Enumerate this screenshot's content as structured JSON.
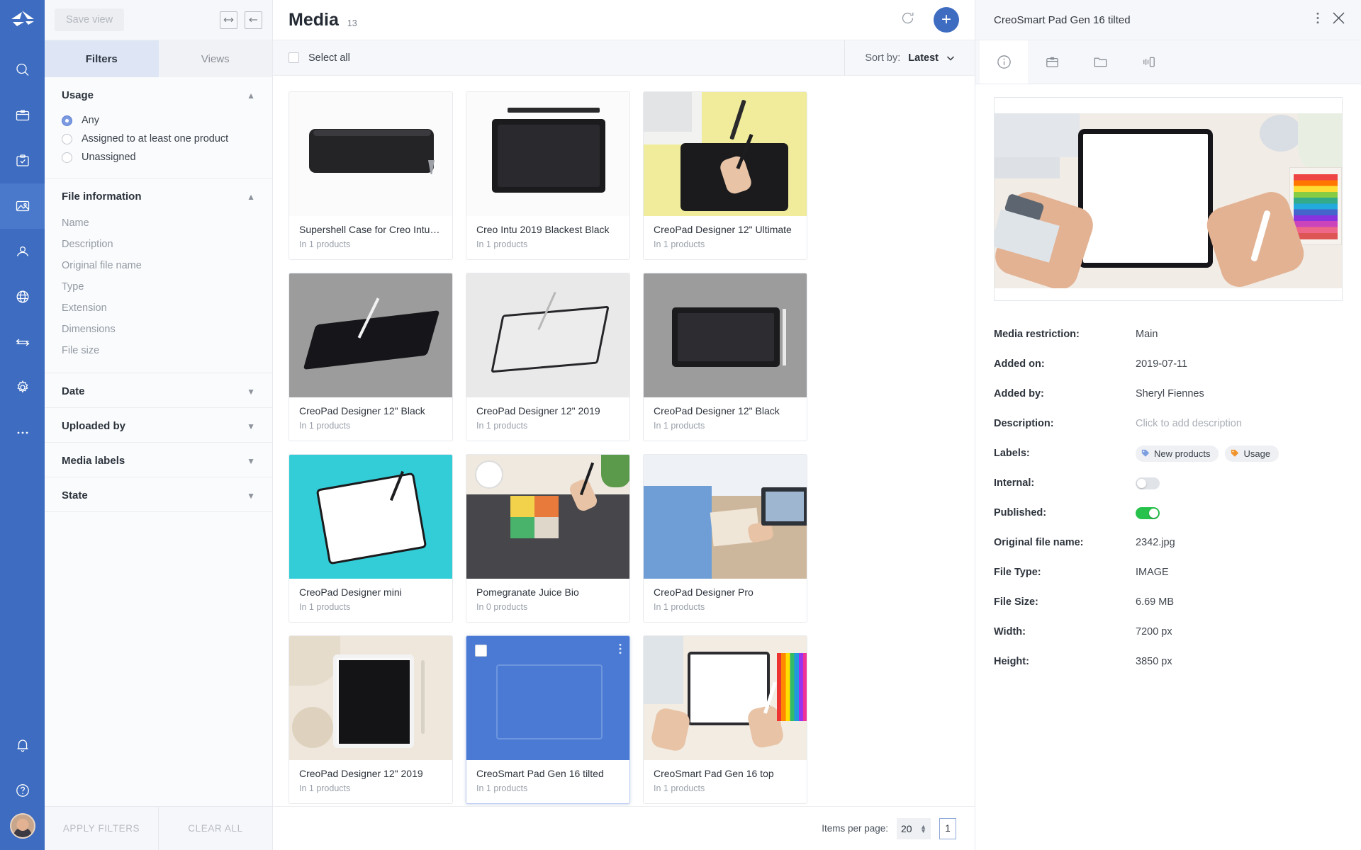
{
  "rail": {
    "logo_name": "app-logo",
    "items": [
      {
        "name": "search-icon",
        "label": "Search"
      },
      {
        "name": "products-icon",
        "label": "Products"
      },
      {
        "name": "tasks-icon",
        "label": "Tasks"
      },
      {
        "name": "media-icon",
        "label": "Media",
        "active": true
      },
      {
        "name": "users-icon",
        "label": "Users"
      },
      {
        "name": "globe-icon",
        "label": "Channels"
      },
      {
        "name": "transfer-icon",
        "label": "Import Export"
      },
      {
        "name": "gear-icon",
        "label": "Settings"
      },
      {
        "name": "more-icon",
        "label": "More"
      }
    ],
    "notifications_icon": "bell-icon",
    "help_icon": "help-icon",
    "avatar": "user-avatar"
  },
  "filters": {
    "save_view_label": "Save view",
    "expand_icon": "expand-horizontal-icon",
    "collapse_icon": "collapse-left-icon",
    "tabs": [
      {
        "label": "Filters",
        "active": true
      },
      {
        "label": "Views",
        "active": false
      }
    ],
    "groups": [
      {
        "title": "Usage",
        "expanded": true,
        "options": [
          {
            "label": "Any",
            "selected": true
          },
          {
            "label": "Assigned to at least one product",
            "selected": false
          },
          {
            "label": "Unassigned",
            "selected": false
          }
        ]
      },
      {
        "title": "File information",
        "expanded": true,
        "items": [
          "Name",
          "Description",
          "Original file name",
          "Type",
          "Extension",
          "Dimensions",
          "File size"
        ]
      },
      {
        "title": "Date",
        "expanded": false
      },
      {
        "title": "Uploaded by",
        "expanded": false
      },
      {
        "title": "Media labels",
        "expanded": false
      },
      {
        "title": "State",
        "expanded": false
      }
    ],
    "apply_label": "APPLY FILTERS",
    "clear_label": "CLEAR ALL"
  },
  "main": {
    "title": "Media",
    "count": "13",
    "refresh_icon": "refresh-icon",
    "add_icon": "plus-icon",
    "select_all_label": "Select all",
    "sort_by_label": "Sort by:",
    "sort_by_value": "Latest",
    "cards": [
      {
        "title": "Supershell Case for Creo Intu …",
        "sub": "In 1 products",
        "art": "case",
        "selected": false
      },
      {
        "title": "Creo Intu 2019 Blackest Black",
        "sub": "In 1 products",
        "art": "tablet-pen-white",
        "selected": false
      },
      {
        "title": "CreoPad Designer 12\" Ultimate",
        "sub": "In 1 products",
        "art": "yellow-desk",
        "selected": false
      },
      {
        "title": "CreoPad Designer 12\" Black",
        "sub": "In 1 products",
        "art": "grey-tilt",
        "selected": false
      },
      {
        "title": "CreoPad Designer 12\" 2019",
        "sub": "In 1 products",
        "art": "lgrey-outline",
        "selected": false
      },
      {
        "title": "CreoPad Designer 12\" Black",
        "sub": "In 1 products",
        "art": "grey-flat",
        "selected": false
      },
      {
        "title": "CreoPad Designer mini",
        "sub": "In 1 products",
        "art": "teal-tablet",
        "selected": false
      },
      {
        "title": "Pomegranate Juice Bio",
        "sub": "In 0 products",
        "art": "desk-swatch",
        "selected": false
      },
      {
        "title": "CreoPad Designer Pro",
        "sub": "In 1 products",
        "art": "office-desk",
        "selected": false
      },
      {
        "title": "CreoPad Designer 12\" 2019",
        "sub": "In 1 products",
        "art": "wood-tablet",
        "selected": false
      },
      {
        "title": "CreoSmart Pad Gen 16 tilted",
        "sub": "In 1 products",
        "art": "selected-blue",
        "selected": true
      },
      {
        "title": "CreoSmart Pad Gen 16 top",
        "sub": "In 1 products",
        "art": "hands-tablet",
        "selected": false
      }
    ],
    "items_per_page_label": "Items per page:",
    "items_per_page_value": "20",
    "page_value": "1"
  },
  "detail": {
    "title": "CreoSmart Pad Gen 16 tilted",
    "more_icon": "more-vertical-icon",
    "close_icon": "close-icon",
    "tabs": [
      {
        "name": "info-icon",
        "active": true
      },
      {
        "name": "product-icon",
        "active": false
      },
      {
        "name": "folder-icon",
        "active": false
      },
      {
        "name": "variants-icon",
        "active": false
      }
    ],
    "properties": [
      {
        "key": "Media restriction:",
        "value": "Main",
        "type": "text"
      },
      {
        "key": "Added on:",
        "value": "2019-07-11",
        "type": "text"
      },
      {
        "key": "Added by:",
        "value": "Sheryl Fiennes",
        "type": "text"
      },
      {
        "key": "Description:",
        "value": "Click to add description",
        "type": "placeholder"
      },
      {
        "key": "Labels:",
        "type": "chips",
        "chips": [
          {
            "label": "New products",
            "color": "#7d9fe0"
          },
          {
            "label": "Usage",
            "color": "#f0932b"
          }
        ]
      },
      {
        "key": "Internal:",
        "type": "toggle",
        "on": false
      },
      {
        "key": "Published:",
        "type": "toggle",
        "on": true
      },
      {
        "key": "Original file name:",
        "value": "2342.jpg",
        "type": "text"
      },
      {
        "key": "File Type:",
        "value": "IMAGE",
        "type": "text"
      },
      {
        "key": "File Size:",
        "value": "6.69 MB",
        "type": "text"
      },
      {
        "key": "Width:",
        "value": "7200 px",
        "type": "text"
      },
      {
        "key": "Height:",
        "value": "3850 px",
        "type": "text"
      }
    ]
  },
  "colors": {
    "brand": "#3d6cc0",
    "toggle_on": "#27c24c",
    "tab_active_bg": "#dee6f6"
  }
}
